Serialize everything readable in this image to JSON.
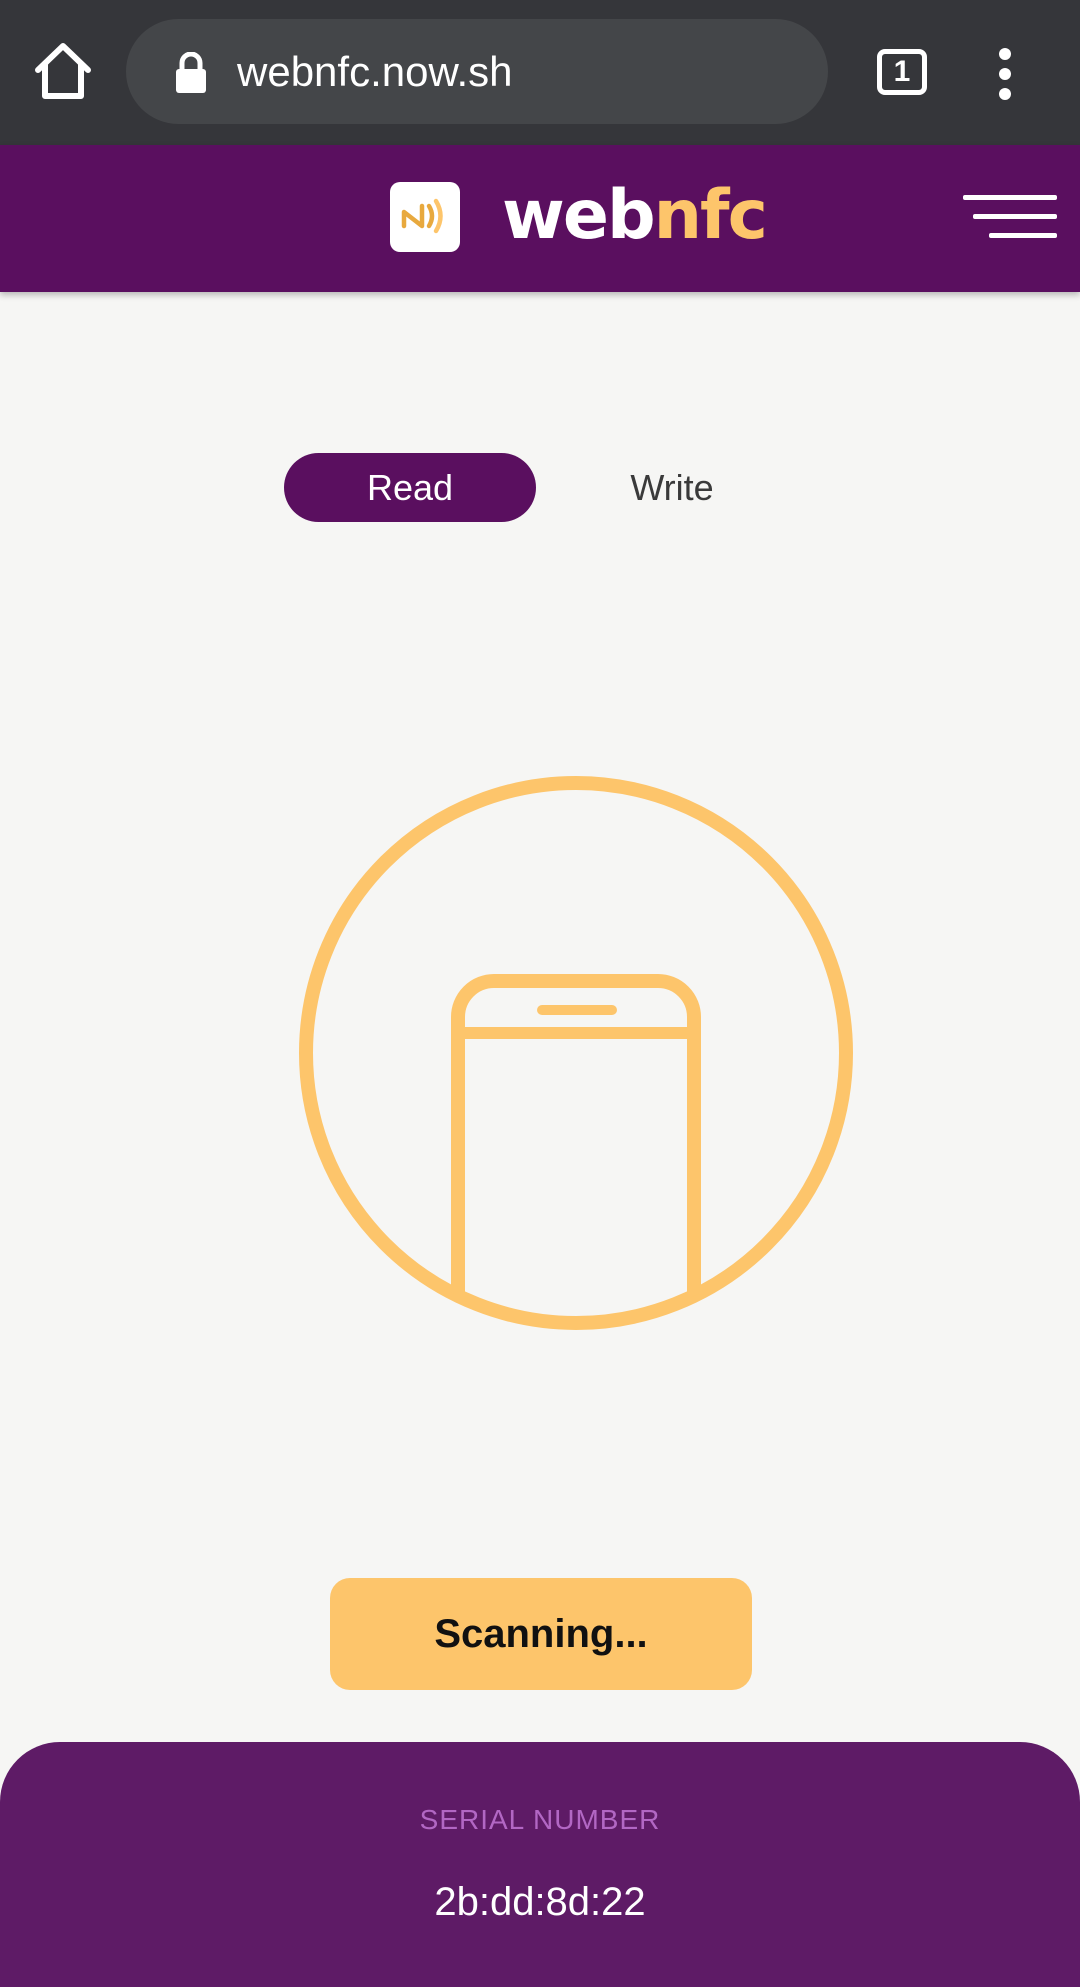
{
  "browser": {
    "url": "webnfc.now.sh",
    "tab_count": "1"
  },
  "header": {
    "logo_part1": "web",
    "logo_part2": "nfc"
  },
  "tabs": [
    {
      "label": "Read",
      "active": true
    },
    {
      "label": "Write",
      "active": false
    }
  ],
  "scan_button_label": "Scanning...",
  "serial": {
    "label": "SERIAL NUMBER",
    "value": "2b:dd:8d:22"
  },
  "colors": {
    "primary": "#5a0f5f",
    "accent": "#fdc56b",
    "background": "#f6f6f4",
    "panel": "#5e1b66"
  },
  "icons": {
    "home": "home-icon",
    "lock": "lock-icon",
    "menu": "more-vert-icon",
    "logo": "nfc-logo-icon",
    "hamburger": "hamburger-menu-icon",
    "illustration": "phone-in-circle-icon"
  }
}
